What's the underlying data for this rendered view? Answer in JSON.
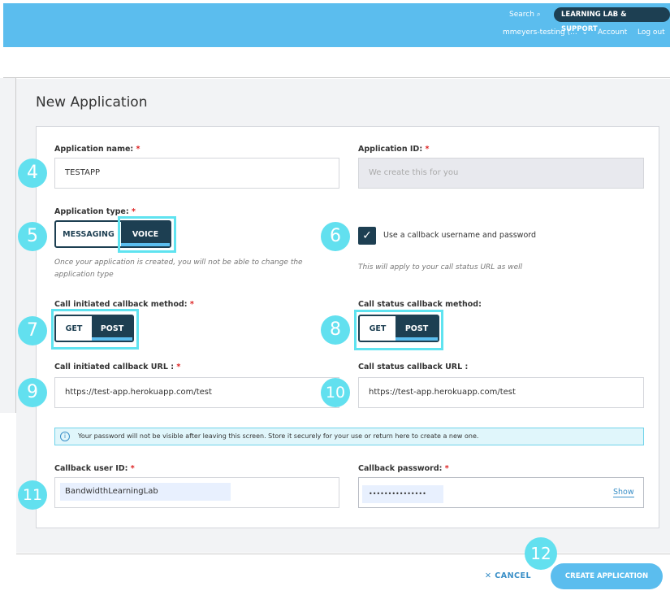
{
  "header": {
    "search": "Search",
    "learning_lab": "LEARNING LAB & SUPPORT",
    "account_name": "mmeyers-testing (...",
    "account": "Account",
    "logout": "Log out"
  },
  "page_title": "New Application",
  "form": {
    "app_name_label": "Application name:",
    "app_name_value": "TESTAPP",
    "app_id_label": "Application ID:",
    "app_id_placeholder": "We create this for you",
    "app_type_label": "Application type:",
    "app_type_options": [
      "MESSAGING",
      "VOICE"
    ],
    "app_type_selected": "VOICE",
    "app_type_hint": "Once your application is created, you will not be able to change the application type",
    "callback_auth_label": "Use a callback username and password",
    "callback_auth_checked": true,
    "callback_auth_hint": "This will apply to your call status URL as well",
    "initiated_method_label": "Call initiated callback method:",
    "status_method_label": "Call status callback method:",
    "methods": [
      "GET",
      "POST"
    ],
    "initiated_method_selected": "POST",
    "status_method_selected": "POST",
    "initiated_url_label": "Call initiated callback URL :",
    "initiated_url_value": "https://test-app.herokuapp.com/test",
    "status_url_label": "Call status callback URL :",
    "status_url_value": "https://test-app.herokuapp.com/test",
    "info": "Your password will not be visible after leaving this screen. Store it securely for your use or return here to create a new one.",
    "user_id_label": "Callback user ID:",
    "user_id_value": "BandwidthLearningLab",
    "password_label": "Callback password:",
    "password_value": "•••••••••••••••",
    "show": "Show",
    "required_mark": "*"
  },
  "callouts": [
    "4",
    "5",
    "6",
    "7",
    "8",
    "9",
    "10",
    "11",
    "12"
  ],
  "footer": {
    "cancel": "CANCEL",
    "create": "CREATE APPLICATION"
  },
  "colors": {
    "header": "#5bbdee",
    "dark": "#1d3f52",
    "callout": "#62e0ef"
  }
}
